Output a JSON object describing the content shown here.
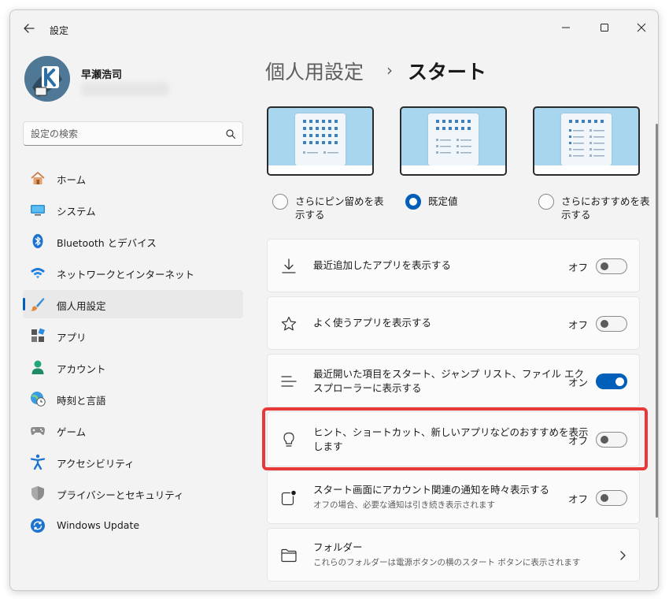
{
  "window": {
    "title": "設定"
  },
  "user": {
    "name": "早瀬浩司"
  },
  "search": {
    "placeholder": "設定の検索"
  },
  "nav": [
    {
      "label": "ホーム",
      "icon": "home-icon",
      "active": false
    },
    {
      "label": "システム",
      "icon": "system-icon",
      "active": false
    },
    {
      "label": "Bluetooth とデバイス",
      "icon": "bluetooth-icon",
      "active": false
    },
    {
      "label": "ネットワークとインターネット",
      "icon": "wifi-icon",
      "active": false
    },
    {
      "label": "個人用設定",
      "icon": "brush-icon",
      "active": true
    },
    {
      "label": "アプリ",
      "icon": "apps-icon",
      "active": false
    },
    {
      "label": "アカウント",
      "icon": "account-icon",
      "active": false
    },
    {
      "label": "時刻と言語",
      "icon": "time-language-icon",
      "active": false
    },
    {
      "label": "ゲーム",
      "icon": "gamepad-icon",
      "active": false
    },
    {
      "label": "アクセシビリティ",
      "icon": "accessibility-icon",
      "active": false
    },
    {
      "label": "プライバシーとセキュリティ",
      "icon": "shield-icon",
      "active": false
    },
    {
      "label": "Windows Update",
      "icon": "update-icon",
      "active": false
    }
  ],
  "breadcrumb": {
    "parent": "個人用設定",
    "separator": "›",
    "current": "スタート"
  },
  "layout_options": [
    {
      "label_line1": "さらにピン留めを表",
      "label_line2": "示する",
      "selected": false
    },
    {
      "label_line1": "既定値",
      "label_line2": "",
      "selected": true
    },
    {
      "label_line1": "さらにおすすめを表",
      "label_line2": "示する",
      "selected": false
    }
  ],
  "settings": [
    {
      "title": "最近追加したアプリを表示する",
      "state": "オフ",
      "on": false,
      "icon": "download-icon"
    },
    {
      "title": "よく使うアプリを表示する",
      "state": "オフ",
      "on": false,
      "icon": "star-icon"
    },
    {
      "title_line1": "最近開いた項目をスタート、ジャンプ リスト、ファイル エク",
      "title_line2": "スプローラーに表示する",
      "state": "オン",
      "on": true,
      "icon": "list-icon"
    },
    {
      "title_line1": "ヒント、ショートカット、新しいアプリなどのおすすめを表示",
      "title_line2": "します",
      "state": "オフ",
      "on": false,
      "icon": "lightbulb-icon"
    },
    {
      "title": "スタート画面にアカウント関連の通知を時々表示する",
      "description": "オフの場合、必要な通知は引き続き表示されます",
      "state": "オフ",
      "on": false,
      "icon": "notification-icon"
    },
    {
      "title": "フォルダー",
      "description": "これらのフォルダーは電源ボタンの横のスタート ボタンに表示されます",
      "icon": "folder-icon"
    }
  ],
  "colors": {
    "accent": "#005fb8",
    "highlight": "#e8393a"
  }
}
